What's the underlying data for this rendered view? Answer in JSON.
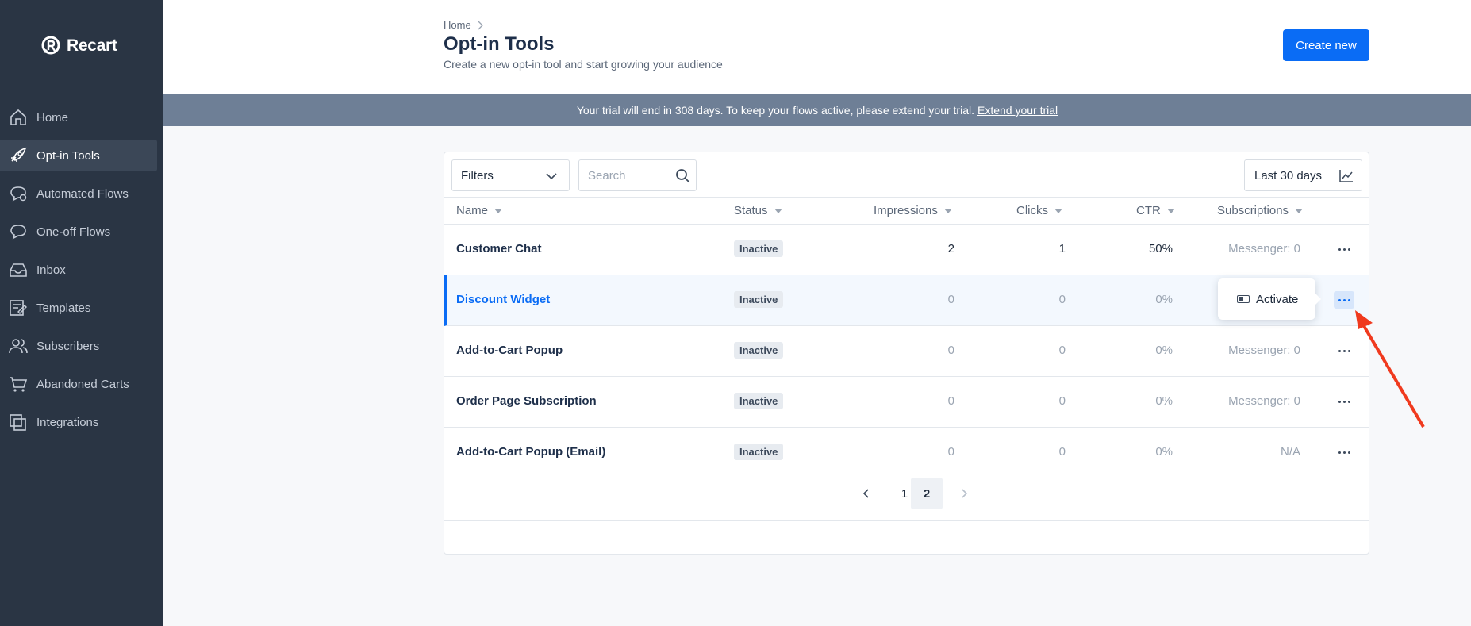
{
  "app": {
    "logo_text": "Recart"
  },
  "sidebar": {
    "items": [
      {
        "label": "Home",
        "icon": "home-icon",
        "active": false
      },
      {
        "label": "Opt-in Tools",
        "icon": "rocket-icon",
        "active": true
      },
      {
        "label": "Automated Flows",
        "icon": "chat-gear-icon",
        "active": false
      },
      {
        "label": "One-off Flows",
        "icon": "chat-icon",
        "active": false
      },
      {
        "label": "Inbox",
        "icon": "inbox-icon",
        "active": false
      },
      {
        "label": "Templates",
        "icon": "template-icon",
        "active": false
      },
      {
        "label": "Subscribers",
        "icon": "users-icon",
        "active": false
      },
      {
        "label": "Abandoned Carts",
        "icon": "cart-icon",
        "active": false
      },
      {
        "label": "Integrations",
        "icon": "integrations-icon",
        "active": false
      }
    ]
  },
  "header": {
    "breadcrumb": "Home",
    "title": "Opt-in Tools",
    "subtitle": "Create a new opt-in tool and start growing your audience",
    "create_label": "Create new"
  },
  "banner": {
    "text": "Your trial will end in 308 days. To keep your flows active, please extend your trial.",
    "link": "Extend your trial"
  },
  "toolbar": {
    "filters_label": "Filters",
    "search_placeholder": "Search",
    "date_range": "Last 30 days"
  },
  "table": {
    "columns": [
      "Name",
      "Status",
      "Impressions",
      "Clicks",
      "CTR",
      "Subscriptions"
    ],
    "rows": [
      {
        "name": "Customer Chat",
        "status": "Inactive",
        "impressions": "2",
        "clicks": "1",
        "ctr": "50%",
        "subscriptions": "Messenger: 0"
      },
      {
        "name": "Discount Widget",
        "status": "Inactive",
        "impressions": "0",
        "clicks": "0",
        "ctr": "0%",
        "subscriptions": ""
      },
      {
        "name": "Add-to-Cart Popup",
        "status": "Inactive",
        "impressions": "0",
        "clicks": "0",
        "ctr": "0%",
        "subscriptions": "Messenger: 0"
      },
      {
        "name": "Order Page Subscription",
        "status": "Inactive",
        "impressions": "0",
        "clicks": "0",
        "ctr": "0%",
        "subscriptions": "Messenger: 0"
      },
      {
        "name": "Add-to-Cart Popup (Email)",
        "status": "Inactive",
        "impressions": "0",
        "clicks": "0",
        "ctr": "0%",
        "subscriptions": "N/A"
      }
    ]
  },
  "popover": {
    "label": "Activate"
  },
  "pagination": {
    "pages": [
      "1",
      "2"
    ],
    "current": "2"
  },
  "colors": {
    "accent": "#0a6cf5",
    "sidebar": "#2a3544",
    "banner": "#6e7f96",
    "arrow": "#f03a1e"
  }
}
